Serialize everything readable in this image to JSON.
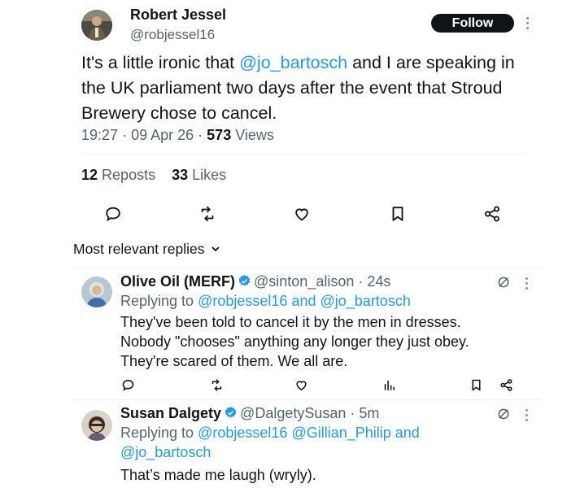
{
  "tweet": {
    "author_name": "Robert Jessel",
    "author_handle": "@robjessel16",
    "follow_label": "Follow",
    "text_before": "It's a little ironic that ",
    "mention": "@jo_bartosch",
    "text_after": " and I are speaking in the UK parliament two days after the event that Stroud Brewery chose to cancel.",
    "time": "19:27",
    "date": "09 Apr 26",
    "separator": "·",
    "views_count": "573",
    "views_label": "Views",
    "reposts_count": "12",
    "reposts_label": "Reposts",
    "likes_count": "33",
    "likes_label": "Likes",
    "actions": [
      "reply-icon",
      "repost-icon",
      "like-icon",
      "bookmark-icon",
      "share-icon"
    ]
  },
  "replies_heading": "Most relevant replies",
  "replies_heading_icon": "chevron-down-icon",
  "replies": [
    {
      "name": "Olive Oil (MERF)",
      "handle": "@sinton_alison",
      "age": "24s",
      "replying_prefix": "Replying to",
      "replying_to_1": "@robjessel16",
      "replying_joiner": "and",
      "replying_to_2": "@jo_bartosch",
      "line1": "They've been told to cancel it by the men in dresses.",
      "line2": "Nobody \"chooses\" anything any longer they just obey.",
      "line3": "They're scared of them. We all are."
    },
    {
      "name": "Susan Dalgety",
      "handle": "@DalgetySusan",
      "age": "5m",
      "replying_prefix": "Replying to",
      "replying_to_1": "@robjessel16",
      "replying_to_2": "@Gillian_Philip",
      "replying_joiner": "and",
      "replying_to_3": "@jo_bartosch",
      "line1": "That’s made me laugh (wryly)."
    }
  ],
  "colors": {
    "accent": "#1d9bf0",
    "text": "#0f1419",
    "muted": "#536471",
    "follow_bg": "#0f1419"
  }
}
